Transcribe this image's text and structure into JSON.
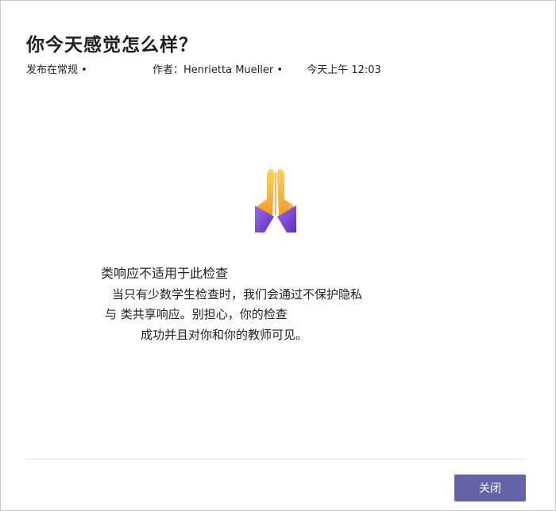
{
  "dialog": {
    "title": "你今天感觉怎么样？",
    "meta": {
      "posted_in": "发布在常规 •",
      "author": "作者：Henrietta Mueller •",
      "time": "今天上午 12:03"
    },
    "icon": "folded-hands-icon",
    "message": {
      "title": "类响应不适用于此检查",
      "line1": "当只有少数学生检查时，我们会通过不保护隐私",
      "line2": "与 类共享响应。别担心，你的检查",
      "line3": "成功并且对你和你的教师可见。"
    },
    "close_label": "关闭"
  },
  "colors": {
    "primary_button": "#6264a7",
    "hand_yellow": "#f7b93a",
    "sleeve_purple": "#7b4fd8"
  }
}
